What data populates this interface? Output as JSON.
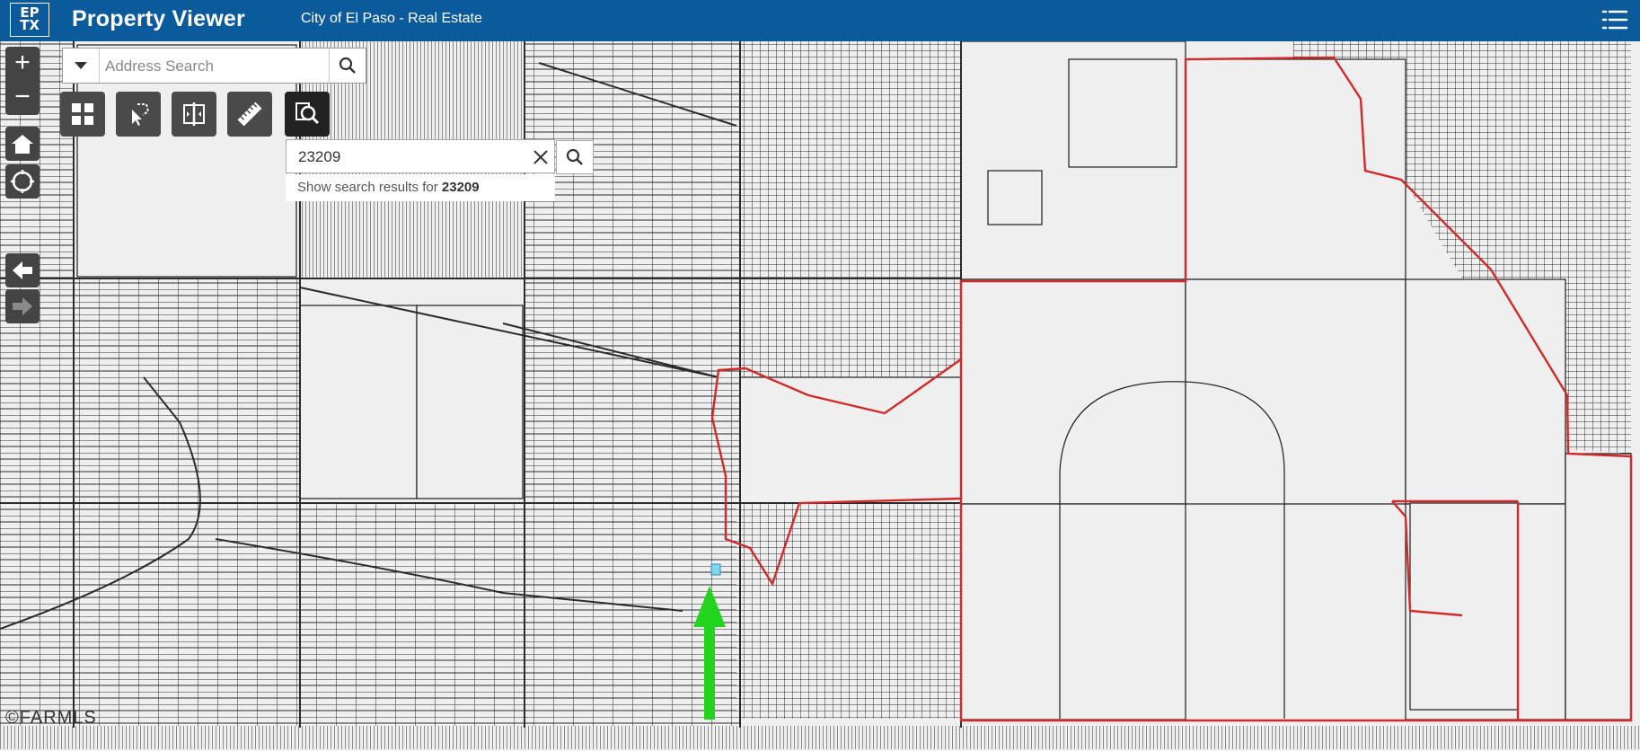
{
  "app": {
    "logo_text": "EP TX",
    "title": "Property Viewer",
    "subtitle": "City of El Paso - Real Estate"
  },
  "icons": {
    "menu": "list-menu-icon",
    "zoom_in": "plus-icon",
    "zoom_out": "minus-icon",
    "home": "home-icon",
    "locate": "locate-icon",
    "back": "arrow-left-icon",
    "forward": "arrow-right-icon",
    "tool_basemap": "grid-icon",
    "tool_select": "select-icon",
    "tool_swipe": "swipe-icon",
    "tool_measure": "ruler-icon",
    "tool_search": "magnify-icon"
  },
  "address_search": {
    "placeholder": "Address Search",
    "value": ""
  },
  "query_search": {
    "value": "23209",
    "hint_prefix": "Show search results for ",
    "hint_term": "23209"
  },
  "credit": "©FARMLS",
  "colors": {
    "header": "#0b5a9c",
    "map_background": "#efefef",
    "parcel_lines": "#2b2b2b",
    "boundary": "#d22a2a",
    "selected_parcel": "#7fd4ee",
    "arrow": "#22d41e",
    "control": "#444444"
  }
}
